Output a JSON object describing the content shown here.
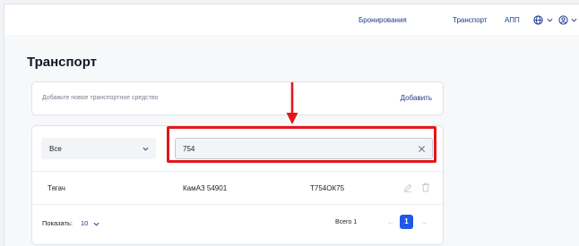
{
  "nav": {
    "bookings": "Бронирования",
    "transport": "Транспорт",
    "app": "АПП",
    "language_icon": "globe-icon",
    "user_icon": "user-icon"
  },
  "page": {
    "title": "Транспорт"
  },
  "add_card": {
    "placeholder": "Добавьте новое транспортное средство",
    "add_label": "Добавить"
  },
  "filters": {
    "type_selected": "Все",
    "search_value": "754"
  },
  "table": {
    "rows": [
      {
        "type": "Тягач",
        "model": "КамАЗ 54901",
        "plate": "Т754ОК75"
      }
    ]
  },
  "pagination": {
    "show_label": "Показать:",
    "per_page": "10",
    "total": "Всего 1",
    "current_page": "1",
    "prev": "←",
    "next": "→"
  },
  "colors": {
    "accent": "#1f58e6",
    "link": "#1f3b8f",
    "annotation_red": "#e3171b"
  }
}
